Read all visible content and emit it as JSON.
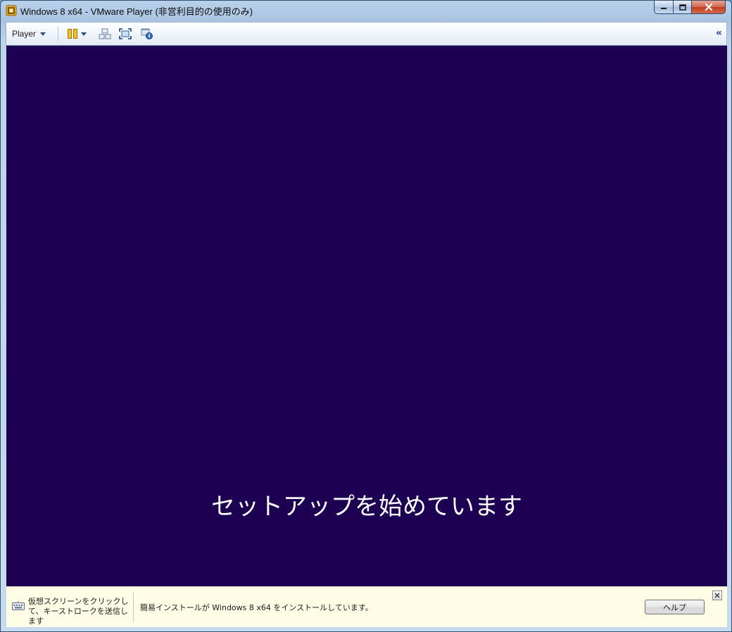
{
  "window": {
    "title": "Windows 8 x64 - VMware Player (非営利目的の使用のみ)"
  },
  "toolbar": {
    "player_label": "Player",
    "icons": [
      "pause-icon",
      "send-ctrl-alt-del-icon",
      "full-screen-icon",
      "unity-icon"
    ],
    "collapse_label": "«"
  },
  "vm": {
    "setup_text": "セットアップを始めています",
    "background_color": "#1d0051"
  },
  "infobar": {
    "hint": "仮想スクリーンをクリックして、キーストロークを送信します",
    "message": "簡易インストールが Windows 8 x64 をインストールしています。",
    "help_label": "ヘルプ"
  }
}
